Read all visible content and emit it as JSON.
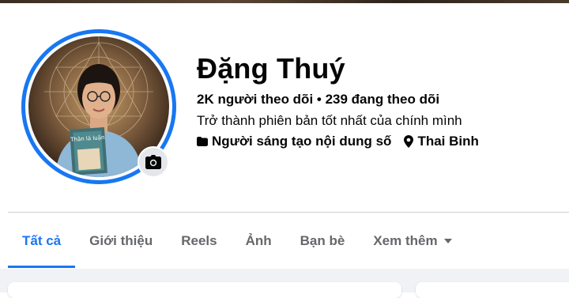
{
  "profile": {
    "name": "Đặng Thuý",
    "followers_line": "2K người theo dõi • 239 đang theo dõi",
    "bio": "Trở thành phiên bản tốt nhất của chính mình",
    "category": "Người sáng tạo nội dung số",
    "location": "Thai Binh",
    "book_title": "Thân lá luận",
    "icons": {
      "category": "content-creator-icon",
      "location": "location-pin-icon",
      "camera": "camera-icon"
    }
  },
  "colors": {
    "accent": "#1877f2",
    "muted_text": "#65676b",
    "page_bg": "#f0f2f5"
  },
  "tabs": [
    {
      "label": "Tất cả",
      "active": true
    },
    {
      "label": "Giới thiệu"
    },
    {
      "label": "Reels"
    },
    {
      "label": "Ảnh"
    },
    {
      "label": "Bạn bè"
    },
    {
      "label": "Xem thêm",
      "has_dropdown": true
    }
  ]
}
